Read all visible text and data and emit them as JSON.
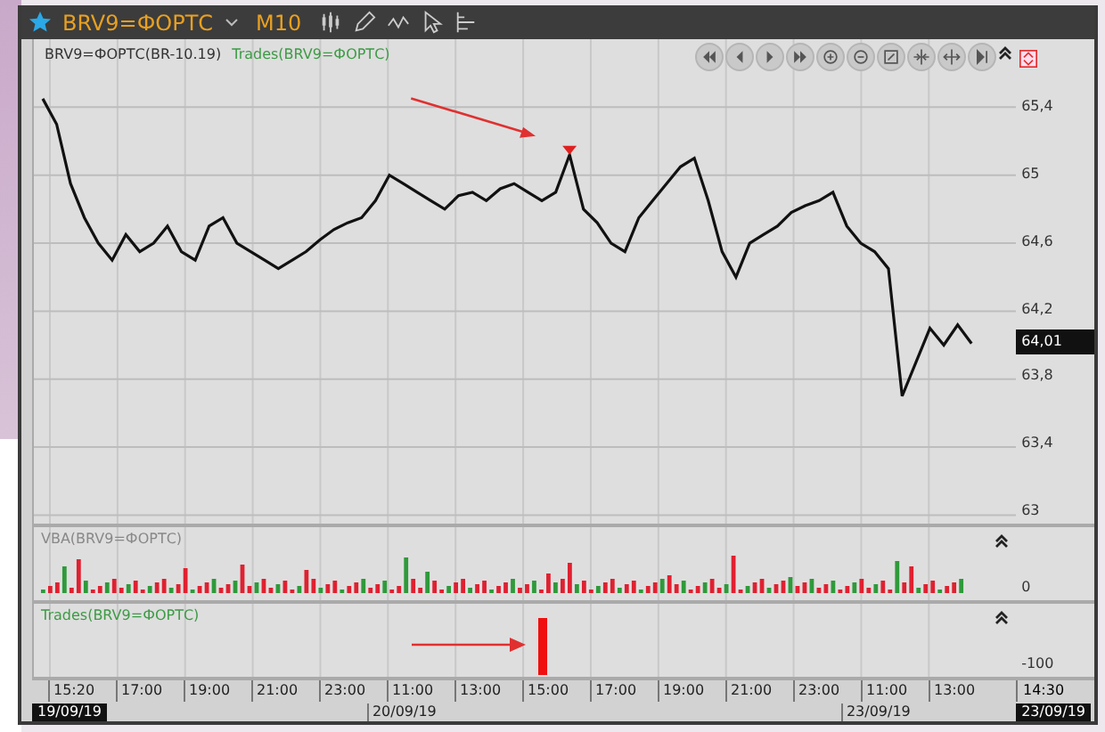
{
  "window": {
    "symbol": "BRV9=ФОРТС",
    "timeframe": "M10"
  },
  "chart": {
    "legend": "BRV9=ФОРТС(BR-10.19)",
    "overlay_legend": "Trades(BRV9=ФОРТС)",
    "last_price": "64,01",
    "chart_data": {
      "type": "line",
      "grid": true,
      "ylim": [
        62.95,
        65.8
      ],
      "yticks": [
        {
          "value": 65.4,
          "label": "65,4"
        },
        {
          "value": 65,
          "label": "65"
        },
        {
          "value": 64.6,
          "label": "64,6"
        },
        {
          "value": 64.2,
          "label": "64,2"
        },
        {
          "value": 63.8,
          "label": "63,8"
        },
        {
          "value": 63.4,
          "label": "63,4"
        },
        {
          "value": 63,
          "label": "63"
        }
      ],
      "series": [
        {
          "color": "#111111",
          "values": [
            65.45,
            65.3,
            64.95,
            64.75,
            64.6,
            64.5,
            64.65,
            64.55,
            64.6,
            64.7,
            64.55,
            64.5,
            64.7,
            64.75,
            64.6,
            64.55,
            64.5,
            64.45,
            64.5,
            64.55,
            64.62,
            64.68,
            64.72,
            64.75,
            64.85,
            65.0,
            64.95,
            64.9,
            64.85,
            64.8,
            64.88,
            64.9,
            64.85,
            64.92,
            64.95,
            64.9,
            64.85,
            64.9,
            65.12,
            64.8,
            64.72,
            64.6,
            64.55,
            64.75,
            64.85,
            64.95,
            65.05,
            65.1,
            64.85,
            64.55,
            64.4,
            64.6,
            64.65,
            64.7,
            64.78,
            64.82,
            64.85,
            64.9,
            64.7,
            64.6,
            64.55,
            64.45,
            63.7,
            63.9,
            64.1,
            64.0,
            64.12,
            64.01
          ]
        }
      ]
    }
  },
  "volume_panel": {
    "legend": "VBA(BRV9=ФОРТС)",
    "axis_label": "0"
  },
  "trades_panel": {
    "legend": "Trades(BRV9=ФОРТС)",
    "axis_label": "-100"
  },
  "time_axis": {
    "start_date": "19/09/19",
    "end_date": "23/09/19",
    "current_time": "14:30",
    "ticks": [
      {
        "label": "15:20"
      },
      {
        "label": "17:00"
      },
      {
        "label": "19:00"
      },
      {
        "label": "21:00"
      },
      {
        "label": "23:00"
      },
      {
        "label": "11:00",
        "date": "20/09/19"
      },
      {
        "label": "13:00"
      },
      {
        "label": "15:00"
      },
      {
        "label": "17:00"
      },
      {
        "label": "19:00"
      },
      {
        "label": "21:00"
      },
      {
        "label": "23:00"
      },
      {
        "label": "11:00",
        "date": "23/09/19"
      },
      {
        "label": "13:00"
      }
    ]
  }
}
